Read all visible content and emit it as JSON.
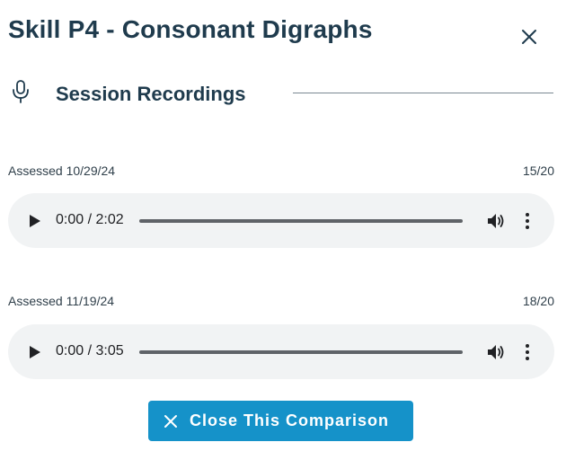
{
  "header": {
    "title": "Skill P4 - Consonant Digraphs",
    "close_icon": "close-icon"
  },
  "section": {
    "icon": "microphone-icon",
    "title": "Session Recordings"
  },
  "recordings": [
    {
      "assessed_label": "Assessed 10/29/24",
      "score": "15/20",
      "time": "0:00 / 2:02",
      "progress": 0
    },
    {
      "assessed_label": "Assessed 11/19/24",
      "score": "18/20",
      "time": "0:00 / 3:05",
      "progress": 0
    }
  ],
  "footer": {
    "close_comparison_label": "Close This Comparison",
    "button_color": "#1592c9"
  },
  "colors": {
    "heading": "#1f3b4d",
    "player_bg": "#f1f3f4"
  }
}
